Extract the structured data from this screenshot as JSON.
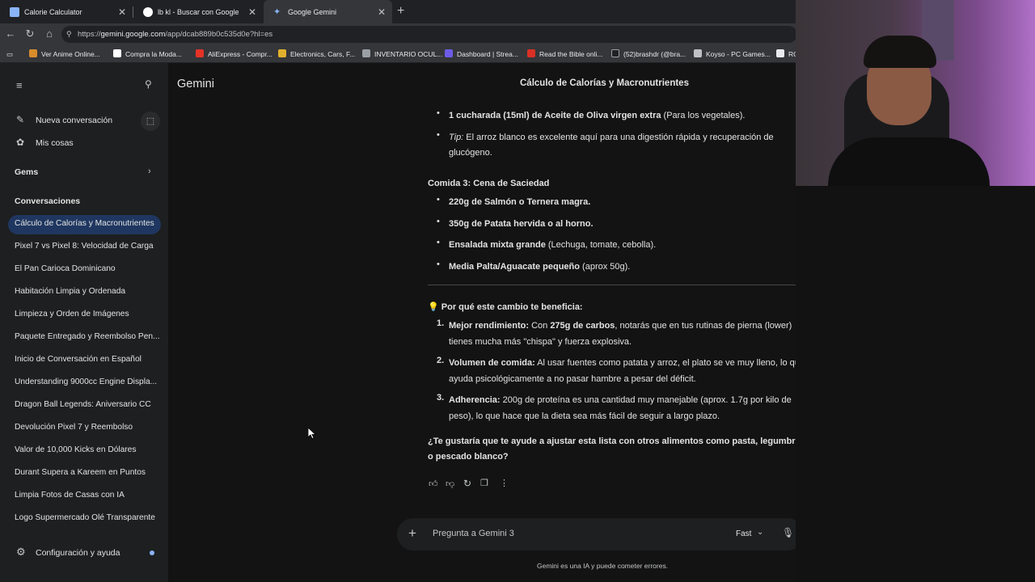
{
  "browser": {
    "tabs": [
      {
        "title": "Calorie Calculator",
        "active": false
      },
      {
        "title": "lb kl - Buscar con Google",
        "active": false
      },
      {
        "title": "Google Gemini",
        "active": true
      }
    ],
    "url_prefix": "https://",
    "url_host": "gemini.google.com",
    "url_path": "/app/dcab889b0c535d0e?hl=es",
    "bookmarks": [
      "Ver Anime Online...",
      "Compra la Moda...",
      "AliExpress - Compr...",
      "Electronics, Cars, F...",
      "INVENTARIO OCUL...",
      "Dashboard | Strea...",
      "Read the Bible onli...",
      "(52)brashdr (@bra...",
      "Koyso - PC Games...",
      "RC"
    ]
  },
  "sidebar": {
    "new_chat": "Nueva conversación",
    "my_stuff": "Mis cosas",
    "gems": "Gems",
    "conversations_header": "Conversaciones",
    "conversations": [
      "Cálculo de Calorías y Macronutrientes",
      "Pixel 7 vs Pixel 8: Velocidad de Carga",
      "El Pan Carioca Dominicano",
      "Habitación Limpia y Ordenada",
      "Limpieza y Orden de Imágenes",
      "Paquete Entregado y Reembolso Pen...",
      "Inicio de Conversación en Español",
      "Understanding 9000cc Engine Displa...",
      "Dragon Ball Legends: Aniversario CC",
      "Devolución Pixel 7 y Reembolso",
      "Valor de 10,000 Kicks en Dólares",
      "Durant Supera a Kareem en Puntos",
      "Limpia Fotos de Casas con IA",
      "Logo Supermercado Olé Transparente"
    ],
    "settings": "Configuración y ayuda"
  },
  "header": {
    "brand": "Gemini",
    "chat_title": "Cálculo de Calorías y Macronutrientes"
  },
  "message": {
    "oil_bold": "1 cucharada (15ml) de Aceite de Oliva virgen extra",
    "oil_rest": " (Para los vegetales).",
    "tip_label": "Tip:",
    "tip_line1": " El arroz blanco es excelente aquí para una digestión rápida y recuperación de",
    "tip_line2": "glucógeno.",
    "meal3_title": "Comida 3: Cena de Saciedad",
    "meal3_items": [
      {
        "bold": "220g de Salmón o Ternera magra.",
        "rest": ""
      },
      {
        "bold": "350g de Patata hervida o al horno.",
        "rest": ""
      },
      {
        "bold": "Ensalada mixta grande",
        "rest": " (Lechuga, tomate, cebolla)."
      },
      {
        "bold": "Media Palta/Aguacate pequeño",
        "rest": " (aprox 50g)."
      }
    ],
    "why_emoji": "💡",
    "why_title": "Por qué este cambio te beneficia:",
    "benefit1_bold": "Mejor rendimiento:",
    "benefit1_a": " Con ",
    "benefit1_b": "275g de carbos",
    "benefit1_c": ", notarás que en tus rutinas de pierna (lower)",
    "benefit1_line2": "tienes mucha más \"chispa\" y fuerza explosiva.",
    "benefit2_bold": "Volumen de comida:",
    "benefit2_a": " Al usar fuentes como patata y arroz, el plato se ve muy lleno, lo que",
    "benefit2_line2": "ayuda psicológicamente a no pasar hambre a pesar del déficit.",
    "benefit3_bold": "Adherencia:",
    "benefit3_a": " 200g de proteína es una cantidad muy manejable (aprox. 1.7g por kilo de",
    "benefit3_line2": "peso), lo que hace que la dieta sea más fácil de seguir a largo plazo.",
    "question_line1": "¿Te gustaría que te ayude a ajustar esta lista con otros alimentos como pasta, legumbres",
    "question_line2": "o pescado blanco?",
    "nums": [
      "1.",
      "2.",
      "3."
    ]
  },
  "input": {
    "placeholder": "Pregunta a Gemini 3",
    "mode": "Fast",
    "disclaimer": "Gemini es una IA y puede cometer errores."
  }
}
